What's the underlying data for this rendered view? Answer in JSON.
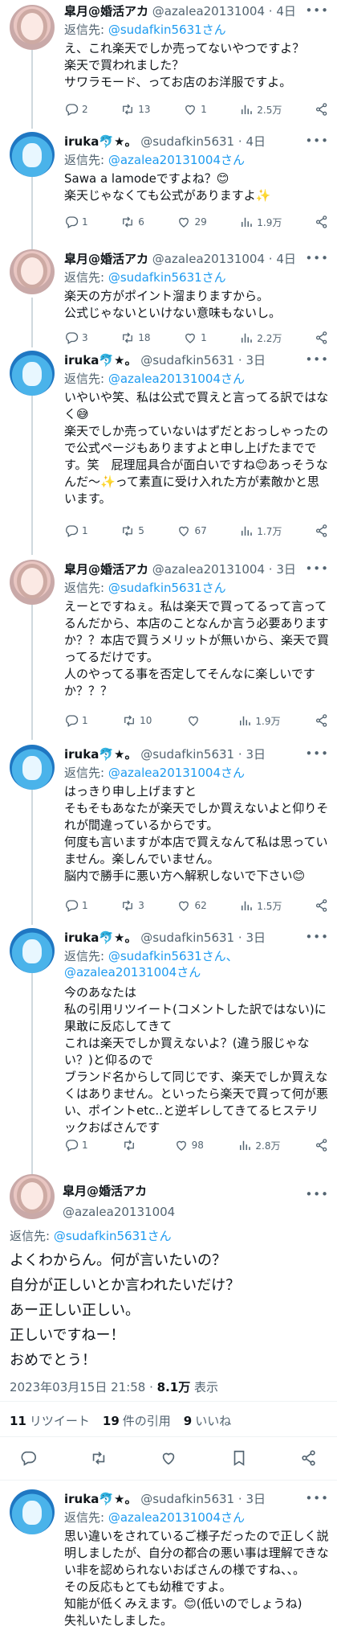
{
  "tweets": [
    {
      "name": "皐月@婚活アカ",
      "handle": "@azalea20131004",
      "time": "4日",
      "reply_label": "返信先: ",
      "reply_to": "@sudafkin5631さん",
      "text": "え、これ楽天でしか売ってないやつですよ？\n楽天で買われました？\nサワラモード、ってお店のお洋服ですよ。",
      "replies": "2",
      "retweets": "13",
      "likes": "1",
      "views": "2.5万"
    },
    {
      "name": "iruka🐬★。",
      "handle": "@sudafkin5631",
      "time": "4日",
      "reply_label": "返信先: ",
      "reply_to": "@azalea20131004さん",
      "text": "Sawa a lamodeですよね？😊\n楽天じゃなくても公式がありますよ✨",
      "replies": "1",
      "retweets": "6",
      "likes": "29",
      "views": "1.9万"
    },
    {
      "name": "皐月@婚活アカ",
      "handle": "@azalea20131004",
      "time": "4日",
      "reply_label": "返信先: ",
      "reply_to": "@sudafkin5631さん",
      "text": "楽天の方がポイント溜まりますから。\n公式じゃないといけない意味もないし。",
      "replies": "3",
      "retweets": "18",
      "likes": "1",
      "views": "2.2万"
    },
    {
      "name": "iruka🐬★。",
      "handle": "@sudafkin5631",
      "time": "3日",
      "reply_label": "返信先: ",
      "reply_to": "@azalea20131004さん",
      "text": "いやいや笑、私は公式で買えと言ってる訳ではなく😅\n楽天でしか売っていないはずだとおっしゃったので公式ページもありますよと申し上げたまでです。笑　屁理屈具合が面白いですね😊あっそうなんだ〜✨って素直に受け入れた方が素敵かと思います。",
      "replies": "1",
      "retweets": "5",
      "likes": "67",
      "views": "1.7万"
    },
    {
      "name": "皐月@婚活アカ",
      "handle": "@azalea20131004",
      "time": "3日",
      "reply_label": "返信先: ",
      "reply_to": "@sudafkin5631さん",
      "text": "えーとですねぇ。私は楽天で買ってるって言ってるんだから、本店のことなんか言う必要ありますか？？本店で買うメリットが無いから、楽天で買ってるだけです。\n人のやってる事を否定してそんなに楽しいですか？？？",
      "replies": "1",
      "retweets": "10",
      "likes": "",
      "views": "1.9万"
    },
    {
      "name": "iruka🐬★。",
      "handle": "@sudafkin5631",
      "time": "3日",
      "reply_label": "返信先: ",
      "reply_to": "@azalea20131004さん",
      "text": "はっきり申し上げますと\nそもそもあなたが楽天でしか買えないよと仰りそれが間違っているからです。\n何度も言いますが本店で買えなんて私は思っていません。楽しんでいません。\n脳内で勝手に悪い方へ解釈しないで下さい😊",
      "replies": "1",
      "retweets": "3",
      "likes": "62",
      "views": "1.5万"
    },
    {
      "name": "iruka🐬★。",
      "handle": "@sudafkin5631",
      "time": "3日",
      "reply_label": "返信先: ",
      "reply_to": "@sudafkin5631さん、\n@azalea20131004さん",
      "text": "今のあなたは\n私の引用リツイート(コメントした訳ではない)に果敢に反応してきて\nこれは楽天でしか買えないよ？(違う服じゃない？)と仰るので\nブランド名からして同じです、楽天でしか買えなくはありません。といったら楽天で買って何が悪い、ポイントetc..と逆ギレしてきてるヒステリックおばさんです",
      "replies": "1",
      "retweets": "",
      "likes": "98",
      "views": "2.8万"
    }
  ],
  "focus": {
    "name": "皐月@婚活アカ",
    "handle": "@azalea20131004",
    "reply_label": "返信先: ",
    "reply_to": "@sudafkin5631さん",
    "lines": [
      "よくわからん。何が言いたいの？",
      "自分が正しいとか言われたいだけ？",
      "あー正しい正しい。",
      "正しいですねー！",
      "おめでとう！"
    ],
    "date": "2023年03月15日 21:58 · ",
    "views_num": "8.1万",
    "views_label": " 表示",
    "rt_num": "11",
    "rt_label": "リツイート",
    "quote_num": "19",
    "quote_label": "件の引用",
    "like_num": "9",
    "like_label": "いいね"
  },
  "last": {
    "name": "iruka🐬★。",
    "handle": "@sudafkin5631",
    "time": "3日",
    "reply_label": "返信先: ",
    "reply_to": "@azalea20131004さん",
    "text": "思い違いをされているご様子だったので正しく説明しましたが、自分の都合の悪い事は理解できない非を認められないおばさんの様ですね、、。\nその反応もとても幼稚ですよ。\n知能が低くみえます。😊(低いのでしょうね)\n失礼いたしました。"
  },
  "colors": {
    "link": "#1d9bf0",
    "muted": "#536471",
    "text": "#0f1419"
  }
}
